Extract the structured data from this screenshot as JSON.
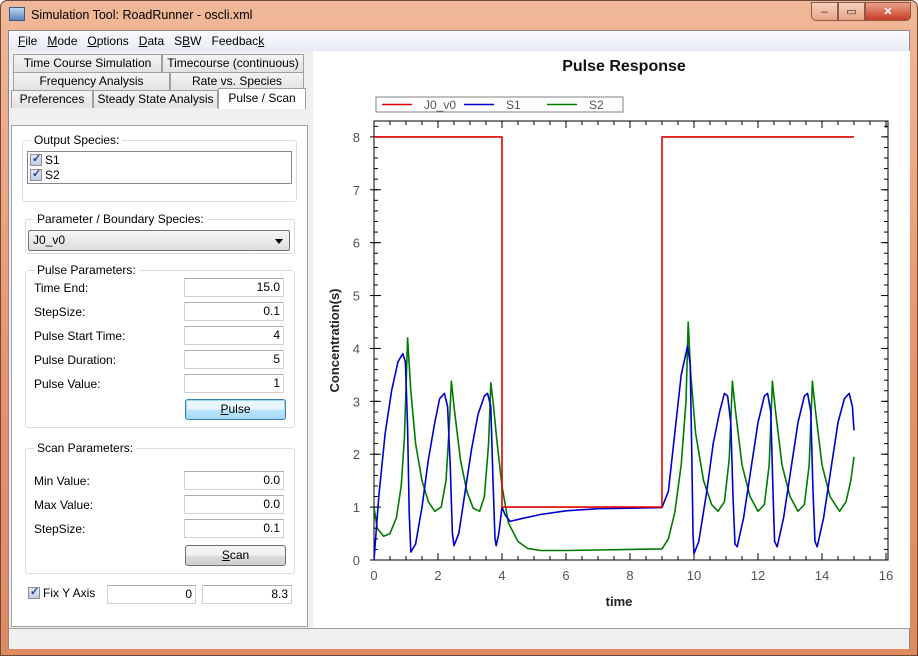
{
  "window": {
    "title": "Simulation Tool: RoadRunner - oscli.xml",
    "buttons": {
      "minimize": "–",
      "maximize": "▭",
      "close": "✕"
    }
  },
  "menubar": [
    {
      "label": "File",
      "accel": "F",
      "rest": "ile"
    },
    {
      "label": "Mode",
      "accel": "M",
      "rest": "ode"
    },
    {
      "label": "Options",
      "accel": "O",
      "rest": "ptions"
    },
    {
      "label": "Data",
      "accel": "D",
      "rest": "ata"
    },
    {
      "label": "SBW",
      "pre": "S",
      "accel": "B",
      "rest": "W"
    },
    {
      "label": "Feedback",
      "pre": "Feedbac",
      "accel": "k",
      "rest": ""
    }
  ],
  "tabs": {
    "row1": [
      "Time Course Simulation",
      "Timecourse (continuous)"
    ],
    "row2": [
      "Frequency Analysis",
      "Rate vs. Species"
    ],
    "row3": [
      "Preferences",
      "Steady State Analysis",
      "Pulse / Scan"
    ],
    "active": "Pulse / Scan"
  },
  "output_species": {
    "label": "Output Species:",
    "items": [
      {
        "name": "S1",
        "checked": true
      },
      {
        "name": "S2",
        "checked": true
      }
    ]
  },
  "parameter": {
    "label": "Parameter / Boundary Species:",
    "selected": "J0_v0"
  },
  "pulse_parameters": {
    "label": "Pulse Parameters:",
    "fields": [
      {
        "label": "Time End:",
        "value": "15.0"
      },
      {
        "label": "StepSize:",
        "value": "0.1"
      },
      {
        "label": "Pulse Start Time:",
        "value": "4"
      },
      {
        "label": "Pulse Duration:",
        "value": "5"
      },
      {
        "label": "Pulse Value:",
        "value": "1"
      }
    ],
    "button": "Pulse",
    "button_accel": "P",
    "button_rest": "ulse"
  },
  "scan_parameters": {
    "label": "Scan Parameters:",
    "fields": [
      {
        "label": "Min Value:",
        "value": "0.0"
      },
      {
        "label": "Max Value:",
        "value": "0.0"
      },
      {
        "label": "StepSize:",
        "value": "0.1"
      }
    ],
    "button": "Scan",
    "button_accel": "S",
    "button_rest": "can"
  },
  "fix_y_axis": {
    "label": "Fix Y Axis",
    "checked": true,
    "min": "0",
    "max": "8.3"
  },
  "chart_data": {
    "type": "line",
    "title": "Pulse Response",
    "xlabel": "time",
    "ylabel": "Concentration(s)",
    "xlim": [
      0,
      16
    ],
    "ylim": [
      0,
      8.3
    ],
    "xticks": [
      0,
      2,
      4,
      6,
      8,
      10,
      12,
      14,
      16
    ],
    "yticks": [
      0,
      1,
      2,
      3,
      4,
      5,
      6,
      7,
      8
    ],
    "grid": false,
    "legend": "top-left",
    "series": [
      {
        "name": "J0_v0",
        "color": "#e00000",
        "points": [
          [
            0,
            8
          ],
          [
            4,
            8
          ],
          [
            4,
            1
          ],
          [
            9,
            1
          ],
          [
            9,
            8
          ],
          [
            15,
            8
          ]
        ]
      },
      {
        "name": "S1",
        "color": "#0000d0",
        "points": [
          [
            0,
            0
          ],
          [
            0.15,
            1.2
          ],
          [
            0.35,
            2.4
          ],
          [
            0.55,
            3.2
          ],
          [
            0.75,
            3.75
          ],
          [
            0.9,
            3.9
          ],
          [
            0.98,
            3.75
          ],
          [
            1.05,
            2.5
          ],
          [
            1.1,
            0.9
          ],
          [
            1.15,
            0.15
          ],
          [
            1.3,
            0.3
          ],
          [
            1.5,
            1.0
          ],
          [
            1.7,
            1.9
          ],
          [
            1.9,
            2.6
          ],
          [
            2.05,
            3.05
          ],
          [
            2.2,
            3.15
          ],
          [
            2.3,
            2.9
          ],
          [
            2.38,
            1.8
          ],
          [
            2.45,
            0.5
          ],
          [
            2.5,
            0.27
          ],
          [
            2.65,
            0.5
          ],
          [
            2.85,
            1.3
          ],
          [
            3.05,
            2.1
          ],
          [
            3.25,
            2.75
          ],
          [
            3.45,
            3.1
          ],
          [
            3.55,
            3.15
          ],
          [
            3.65,
            2.9
          ],
          [
            3.72,
            1.5
          ],
          [
            3.78,
            0.4
          ],
          [
            3.82,
            0.27
          ],
          [
            3.9,
            0.5
          ],
          [
            4.0,
            1.0
          ],
          [
            4.1,
            0.85
          ],
          [
            4.25,
            0.73
          ],
          [
            4.6,
            0.78
          ],
          [
            5.2,
            0.86
          ],
          [
            6.0,
            0.93
          ],
          [
            7.0,
            0.97
          ],
          [
            8.0,
            0.98
          ],
          [
            9.0,
            0.99
          ],
          [
            9.2,
            1.3
          ],
          [
            9.4,
            2.4
          ],
          [
            9.6,
            3.5
          ],
          [
            9.8,
            4.05
          ],
          [
            9.88,
            3.7
          ],
          [
            9.93,
            2.0
          ],
          [
            9.97,
            0.5
          ],
          [
            10.0,
            0.12
          ],
          [
            10.15,
            0.35
          ],
          [
            10.4,
            1.3
          ],
          [
            10.6,
            2.2
          ],
          [
            10.8,
            2.8
          ],
          [
            10.95,
            3.15
          ],
          [
            11.05,
            3.1
          ],
          [
            11.15,
            2.6
          ],
          [
            11.22,
            1.2
          ],
          [
            11.28,
            0.3
          ],
          [
            11.35,
            0.25
          ],
          [
            11.55,
            0.8
          ],
          [
            11.8,
            1.8
          ],
          [
            12.0,
            2.6
          ],
          [
            12.2,
            3.1
          ],
          [
            12.3,
            3.15
          ],
          [
            12.4,
            2.8
          ],
          [
            12.47,
            1.3
          ],
          [
            12.52,
            0.35
          ],
          [
            12.6,
            0.25
          ],
          [
            12.8,
            0.8
          ],
          [
            13.05,
            1.8
          ],
          [
            13.25,
            2.6
          ],
          [
            13.45,
            3.1
          ],
          [
            13.55,
            3.15
          ],
          [
            13.65,
            2.8
          ],
          [
            13.72,
            1.3
          ],
          [
            13.78,
            0.35
          ],
          [
            13.85,
            0.25
          ],
          [
            14.05,
            0.8
          ],
          [
            14.3,
            1.8
          ],
          [
            14.5,
            2.6
          ],
          [
            14.7,
            3.05
          ],
          [
            14.85,
            3.15
          ],
          [
            14.95,
            2.9
          ],
          [
            15.0,
            2.45
          ]
        ]
      },
      {
        "name": "S2",
        "color": "#007a00",
        "points": [
          [
            0,
            1.0
          ],
          [
            0.1,
            0.6
          ],
          [
            0.3,
            0.45
          ],
          [
            0.5,
            0.5
          ],
          [
            0.7,
            0.8
          ],
          [
            0.85,
            1.4
          ],
          [
            0.95,
            2.3
          ],
          [
            1.05,
            4.2
          ],
          [
            1.15,
            3.2
          ],
          [
            1.3,
            2.2
          ],
          [
            1.5,
            1.5
          ],
          [
            1.7,
            1.1
          ],
          [
            1.9,
            0.92
          ],
          [
            2.1,
            1.0
          ],
          [
            2.25,
            1.5
          ],
          [
            2.35,
            2.5
          ],
          [
            2.42,
            3.38
          ],
          [
            2.5,
            2.9
          ],
          [
            2.7,
            1.9
          ],
          [
            2.9,
            1.3
          ],
          [
            3.1,
            0.98
          ],
          [
            3.3,
            0.92
          ],
          [
            3.45,
            1.2
          ],
          [
            3.58,
            2.2
          ],
          [
            3.65,
            3.35
          ],
          [
            3.72,
            3.0
          ],
          [
            3.85,
            2.2
          ],
          [
            4.0,
            1.4
          ],
          [
            4.2,
            0.7
          ],
          [
            4.5,
            0.35
          ],
          [
            4.8,
            0.22
          ],
          [
            5.2,
            0.18
          ],
          [
            6.0,
            0.18
          ],
          [
            7.0,
            0.19
          ],
          [
            8.0,
            0.2
          ],
          [
            9.0,
            0.21
          ],
          [
            9.2,
            0.4
          ],
          [
            9.4,
            0.9
          ],
          [
            9.6,
            1.8
          ],
          [
            9.75,
            3.0
          ],
          [
            9.82,
            4.5
          ],
          [
            9.9,
            3.5
          ],
          [
            10.05,
            2.4
          ],
          [
            10.3,
            1.5
          ],
          [
            10.55,
            1.05
          ],
          [
            10.75,
            0.92
          ],
          [
            10.95,
            1.1
          ],
          [
            11.1,
            1.9
          ],
          [
            11.2,
            3.38
          ],
          [
            11.3,
            2.8
          ],
          [
            11.5,
            1.8
          ],
          [
            11.75,
            1.2
          ],
          [
            12.0,
            0.92
          ],
          [
            12.2,
            1.05
          ],
          [
            12.35,
            1.8
          ],
          [
            12.45,
            3.38
          ],
          [
            12.55,
            2.8
          ],
          [
            12.75,
            1.8
          ],
          [
            13.0,
            1.2
          ],
          [
            13.25,
            0.92
          ],
          [
            13.45,
            1.05
          ],
          [
            13.6,
            1.8
          ],
          [
            13.7,
            3.38
          ],
          [
            13.8,
            2.8
          ],
          [
            14.0,
            1.8
          ],
          [
            14.25,
            1.2
          ],
          [
            14.55,
            0.92
          ],
          [
            14.75,
            1.1
          ],
          [
            14.9,
            1.5
          ],
          [
            15.0,
            1.95
          ]
        ]
      }
    ]
  }
}
